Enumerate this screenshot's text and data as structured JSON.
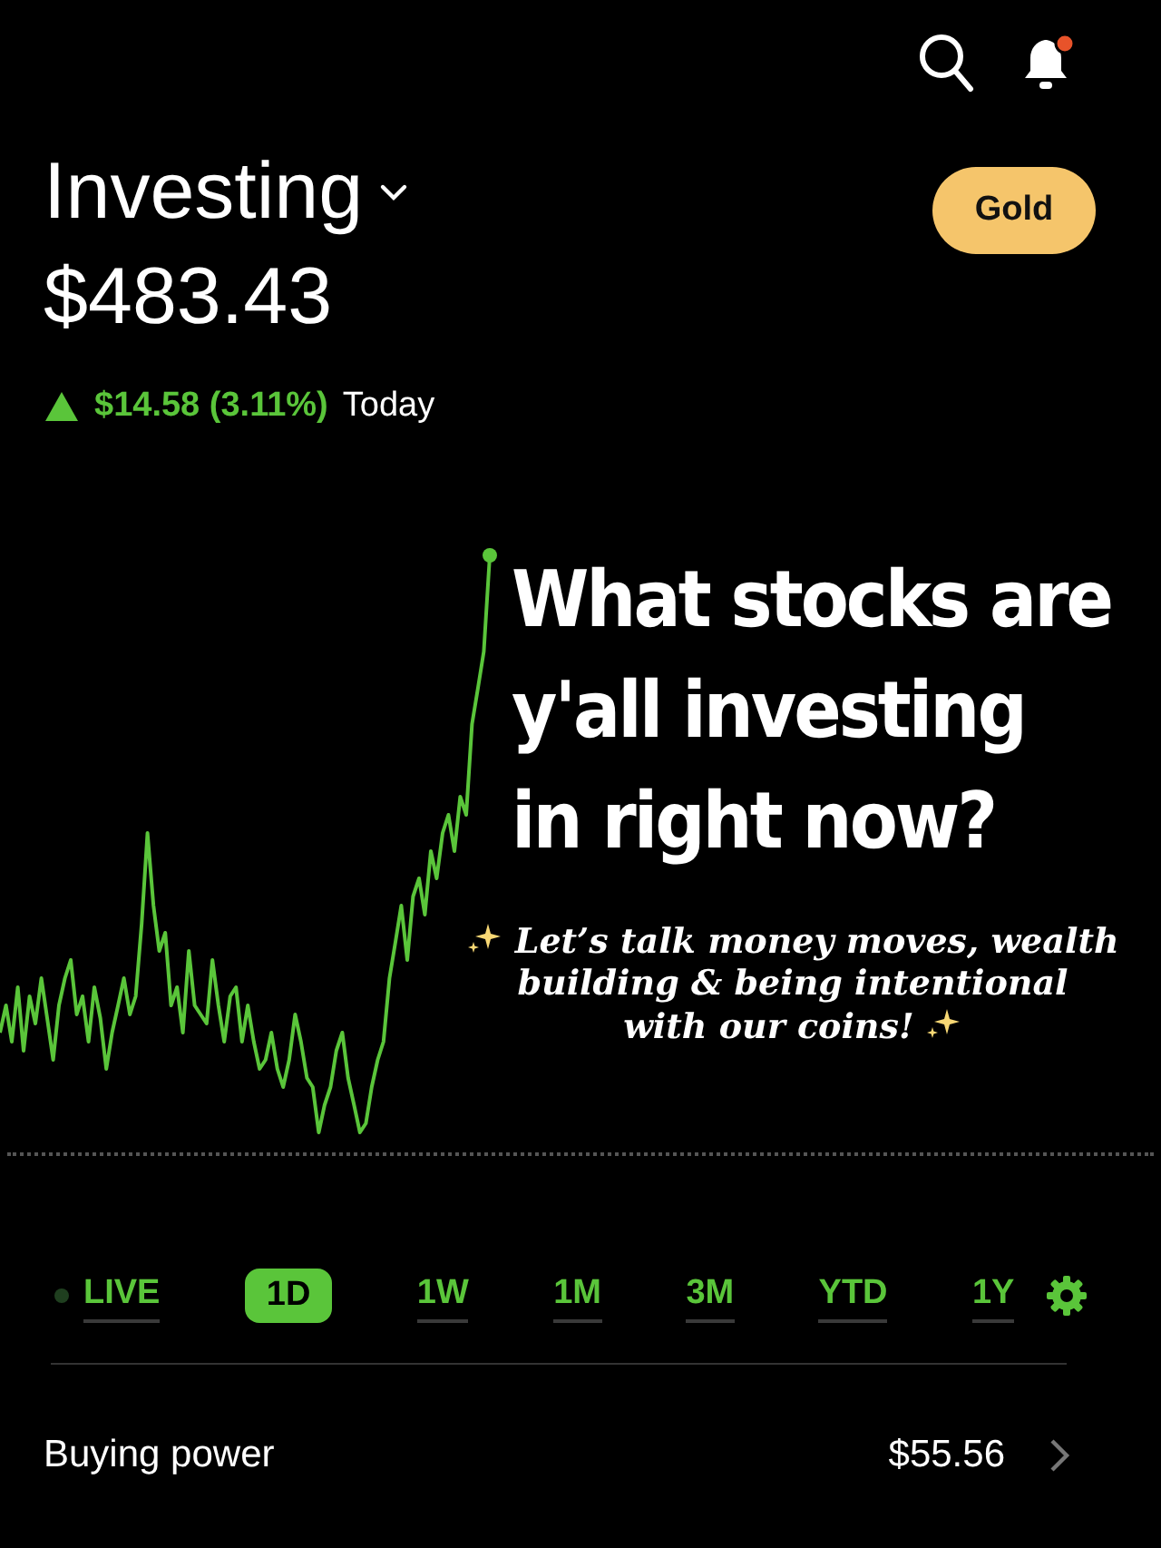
{
  "header": {
    "notification_badge": true
  },
  "account": {
    "title": "Investing",
    "balance": "$483.43",
    "change": "$14.58 (3.11%)",
    "change_period": "Today",
    "rising": true
  },
  "gold_button": "Gold",
  "overlay": {
    "headline_lines": [
      "What stocks are",
      "y'all investing",
      "in right now?"
    ],
    "caption_lines": [
      "Let’s talk money moves, wealth",
      "building & being intentional",
      "with our coins!"
    ]
  },
  "ranges": [
    {
      "label": "LIVE",
      "kind": "live",
      "selected": false
    },
    {
      "label": "1D",
      "kind": "range",
      "selected": true
    },
    {
      "label": "1W",
      "kind": "range",
      "selected": false
    },
    {
      "label": "1M",
      "kind": "range",
      "selected": false
    },
    {
      "label": "3M",
      "kind": "range",
      "selected": false
    },
    {
      "label": "YTD",
      "kind": "range",
      "selected": false
    },
    {
      "label": "1Y",
      "kind": "range",
      "selected": false
    }
  ],
  "buying_power": {
    "label": "Buying power",
    "value": "$55.56"
  }
}
